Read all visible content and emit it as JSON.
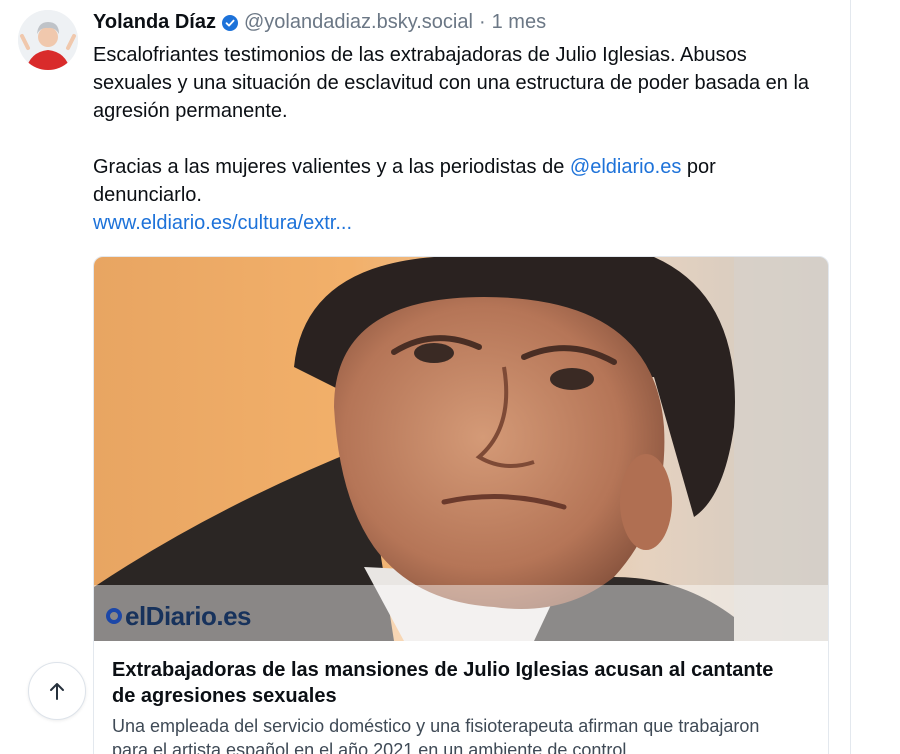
{
  "post": {
    "author": {
      "display_name": "Yolanda Díaz",
      "handle": "@yolandadiaz.bsky.social",
      "verified_icon": "verified-check-icon"
    },
    "meta_dot": "·",
    "timestamp": "1 mes",
    "text": {
      "line1": "Escalofriantes testimonios de las extrabajadoras de Julio Iglesias. Abusos sexuales y una situación de esclavitud con una estructura de poder basada en la agresión permanente.",
      "line2_prefix": "Gracias a las mujeres valientes y a las periodistas de ",
      "mention": "@eldiario.es",
      "line2_suffix": " por denunciarlo.",
      "link": "www.eldiario.es/cultura/extr..."
    },
    "embed": {
      "source_logo": "elDiario.es",
      "title": "Extrabajadoras de las mansiones de Julio Iglesias acusan al cantante de agresiones sexuales",
      "description": "Una empleada del servicio doméstico y una fisioterapeuta afirman que trabajaron para el artista español en el año 2021 en un ambiente de control"
    }
  },
  "ui": {
    "scroll_top_icon": "arrow-up-icon",
    "accent_color": "#1d72d9",
    "verified_color": "#1d72d9"
  }
}
